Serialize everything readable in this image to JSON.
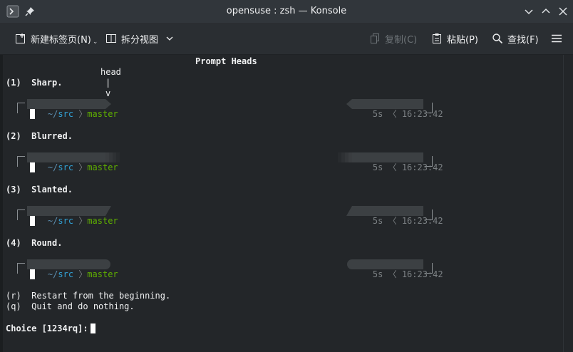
{
  "window": {
    "title": "opensuse : zsh — Konsole"
  },
  "toolbar": {
    "new_tab": "新建标签页(N)",
    "split_view": "拆分视图",
    "copy": "复制(C)",
    "paste": "粘贴(P)",
    "find": "查找(F)"
  },
  "terminal": {
    "heading": "Prompt Heads",
    "annotation_head": "head",
    "annotation_bar": "|",
    "annotation_v": "v",
    "options": [
      {
        "label": "(1)  Sharp."
      },
      {
        "label": "(2)  Blurred."
      },
      {
        "label": "(3)  Slanted."
      },
      {
        "label": "(4)  Round."
      }
    ],
    "prompt": {
      "tilde": "~",
      "slash": "/",
      "dir": "src",
      "branch": "master",
      "duration": "5s",
      "time": "16:23:42"
    },
    "restart": "(r)  Restart from the beginning.",
    "quit": "(q)  Quit and do nothing.",
    "choice": "Choice [1234rq]:"
  },
  "colors": {
    "background": "#232629",
    "segment": "#3c4043",
    "dir": "#31a2d6",
    "branch": "#5faf00",
    "dim": "#7c8184"
  }
}
